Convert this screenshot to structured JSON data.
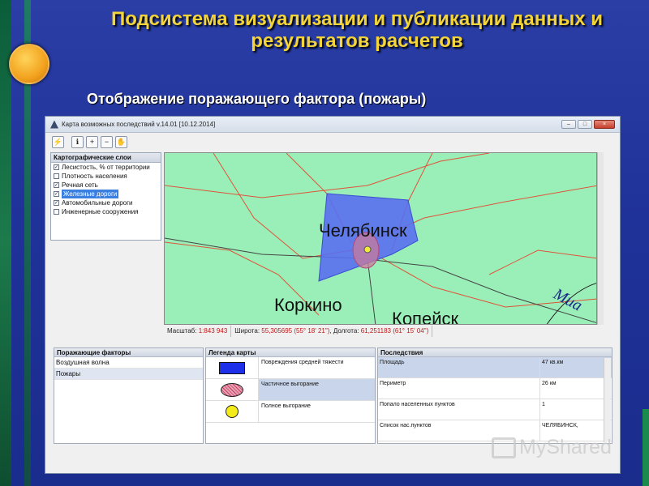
{
  "slide": {
    "title": "Подсистема визуализации и публикации данных и результатов расчетов",
    "subtitle": "Отображение поражающего фактора (пожары)"
  },
  "window": {
    "title": "Карта возможных последствий v.14.01 [10.12.2014]",
    "buttons": [
      "–",
      "□",
      "×"
    ]
  },
  "toolbar": {
    "tools": [
      {
        "name": "lightning-icon",
        "glyph": "⚡"
      },
      {
        "name": "info-icon",
        "glyph": "ℹ"
      },
      {
        "name": "zoom-in-icon",
        "glyph": "+"
      },
      {
        "name": "zoom-out-icon",
        "glyph": "−"
      },
      {
        "name": "hand-icon",
        "glyph": "✋"
      }
    ]
  },
  "layers": {
    "header": "Картографические слои",
    "items": [
      {
        "label": "Лесистость, % от территории",
        "checked": true,
        "selected": false
      },
      {
        "label": "Плотность населения",
        "checked": false,
        "selected": false
      },
      {
        "label": "Речная сеть",
        "checked": true,
        "selected": false
      },
      {
        "label": "Железные дороги",
        "checked": true,
        "selected": true
      },
      {
        "label": "Автомобильные дороги",
        "checked": true,
        "selected": false
      },
      {
        "label": "Инженерные сооружения",
        "checked": false,
        "selected": false
      }
    ]
  },
  "map": {
    "labels": {
      "city_main": "Челябинск",
      "city_2": "Коркино",
      "city_3": "Копейск",
      "city_4": "Миа"
    },
    "colors": {
      "background": "#9aefb8",
      "zone": "#5a6ef0",
      "roads": "#e0533a"
    }
  },
  "status": {
    "scale_label": "Масштаб:",
    "scale_value": "1:843 943",
    "lat_label": "Широта:",
    "lat_value": "55,305695 (55° 18' 21\")",
    "lon_label": "Долгота:",
    "lon_value": "61,251183 (61° 15' 04\")"
  },
  "factors": {
    "header": "Поражающие факторы",
    "items": [
      "Воздушная волна",
      "Пожары"
    ]
  },
  "legend": {
    "header": "Легенда карты",
    "items": [
      "Повреждения средней тяжести",
      "Частичное выгорание",
      "Полное выгорание"
    ]
  },
  "results": {
    "header": "Последствия",
    "rows": [
      {
        "key": "Площадь",
        "value": "47 кв.км"
      },
      {
        "key": "Периметр",
        "value": "26 км"
      },
      {
        "key": "Попало населенных пунктов",
        "value": "1"
      },
      {
        "key": "Список нас.пунктов",
        "value": "ЧЕЛЯБИНСК,"
      }
    ]
  },
  "watermark": {
    "text": "MyShared"
  }
}
